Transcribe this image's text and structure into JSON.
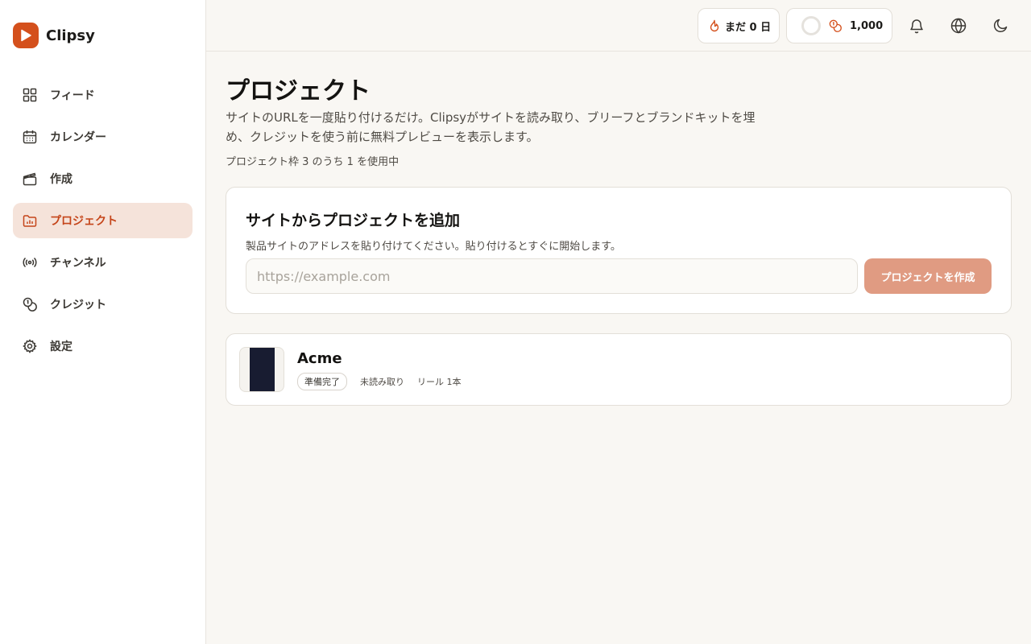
{
  "brand": {
    "name": "Clipsy",
    "accent": "#d4501c"
  },
  "sidebar": {
    "items": [
      {
        "label": "フィード",
        "icon": "grid-icon",
        "active": false
      },
      {
        "label": "カレンダー",
        "icon": "calendar-icon",
        "active": false
      },
      {
        "label": "作成",
        "icon": "clapperboard-icon",
        "active": false
      },
      {
        "label": "プロジェクト",
        "icon": "folder-chart-icon",
        "active": true
      },
      {
        "label": "チャンネル",
        "icon": "broadcast-icon",
        "active": false
      },
      {
        "label": "クレジット",
        "icon": "coins-icon",
        "active": false
      },
      {
        "label": "設定",
        "icon": "gear-icon",
        "active": false
      }
    ]
  },
  "topbar": {
    "streak_label": "まだ 0 日",
    "credits_value": "1,000",
    "icons": [
      "flame-icon",
      "coins-icon",
      "bell-icon",
      "globe-icon",
      "moon-icon"
    ]
  },
  "page": {
    "title": "プロジェクト",
    "description": "サイトのURLを一度貼り付けるだけ。Clipsyがサイトを読み取り、ブリーフとブランドキットを埋め、クレジットを使う前に無料プレビューを表示します。",
    "quota": "プロジェクト枠 3 のうち 1 を使用中"
  },
  "add_project": {
    "title": "サイトからプロジェクトを追加",
    "subtitle": "製品サイトのアドレスを貼り付けてください。貼り付けるとすぐに開始します。",
    "input_placeholder": "https://example.com",
    "input_value": "",
    "button_label": "プロジェクトを作成"
  },
  "projects": [
    {
      "name": "Acme",
      "status": "準備完了",
      "read_state": "未読み取り",
      "reels": "リール 1本"
    }
  ]
}
